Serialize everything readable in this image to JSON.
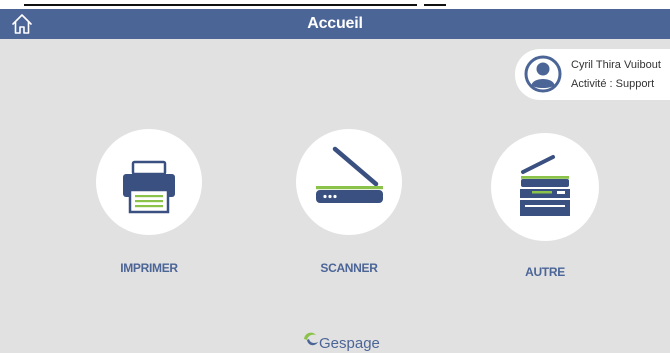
{
  "header": {
    "title": "Accueil",
    "home_icon": "home-icon"
  },
  "user": {
    "name": "Cyril Thira Vuibout",
    "activity": "Activité : Support",
    "avatar_icon": "user-avatar-icon"
  },
  "actions": [
    {
      "label": "IMPRIMER",
      "icon": "printer-icon"
    },
    {
      "label": "SCANNER",
      "icon": "scanner-icon"
    },
    {
      "label": "AUTRE",
      "icon": "multifunction-printer-icon"
    }
  ],
  "footer": {
    "logo_text": "Gespage"
  },
  "colors": {
    "background": "#e1e1e1",
    "header": "#4c6597",
    "icon_navy": "#3a5080",
    "accent_green": "#8bc34a"
  }
}
